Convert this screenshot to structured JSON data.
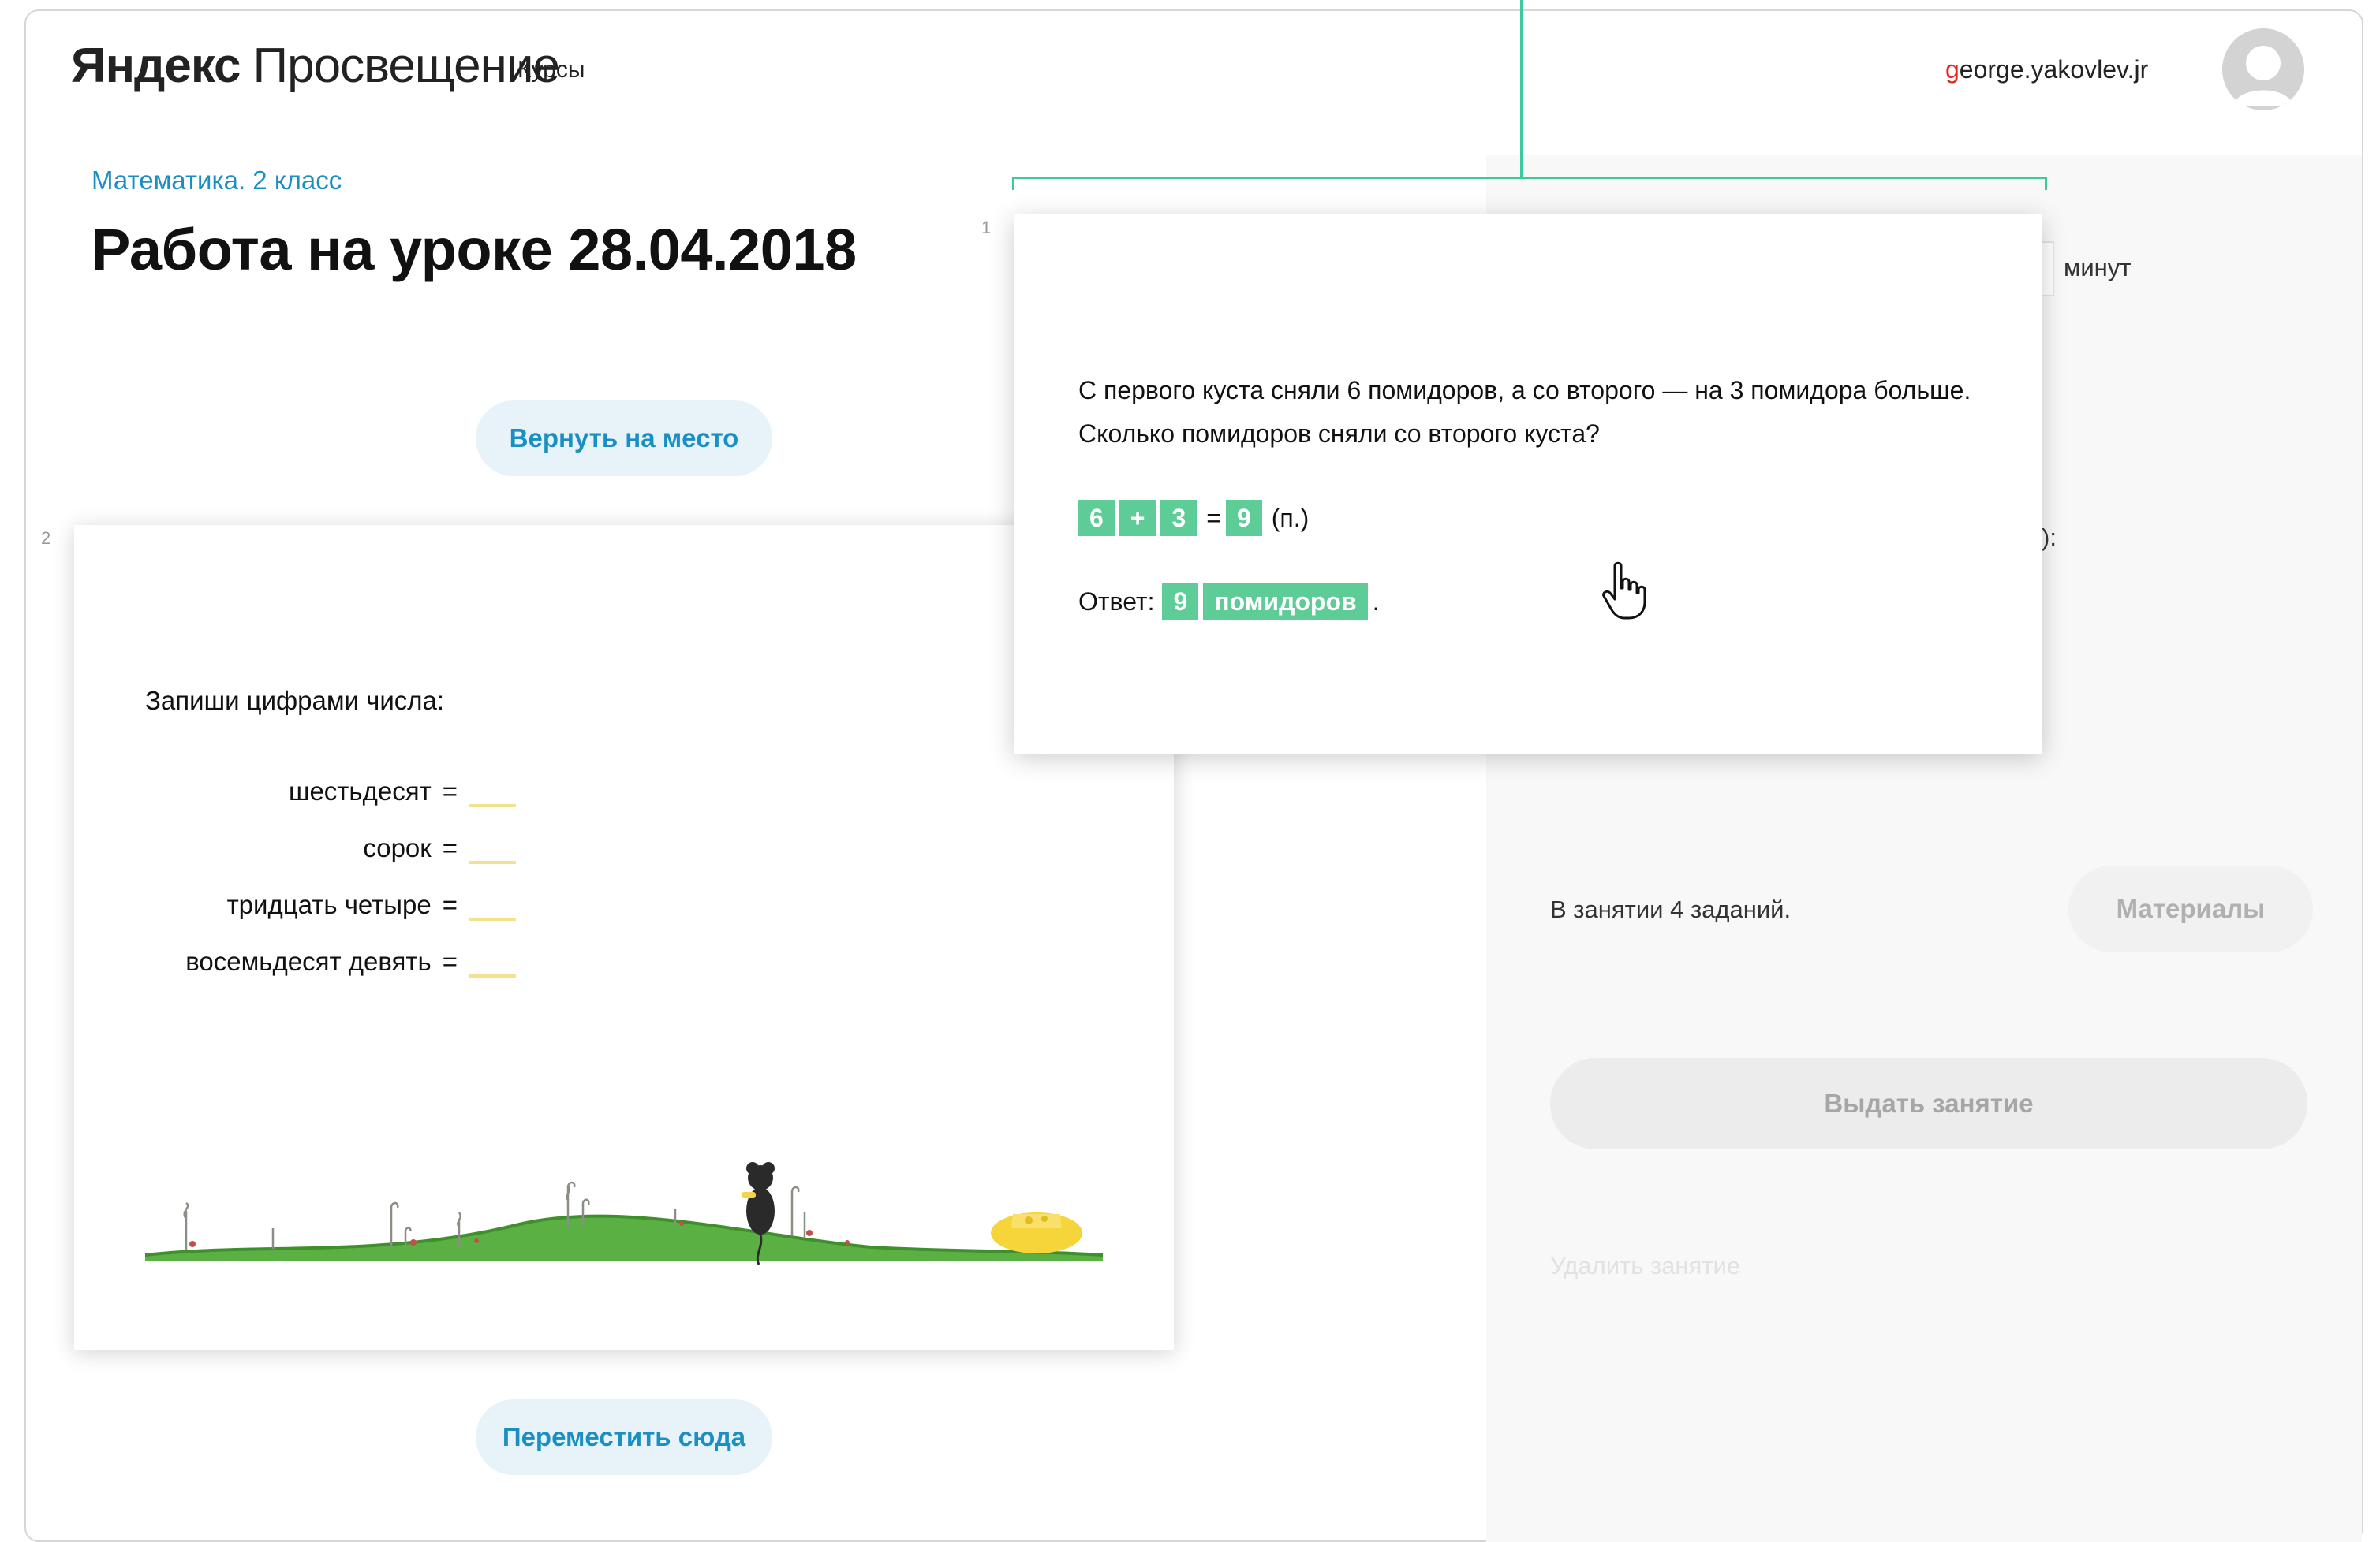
{
  "header": {
    "logo_yandex": "Яндекс",
    "logo_product": "Просвещение",
    "nav_courses": "Курсы",
    "username_first": "g",
    "username_rest": "eorge.yakovlev.jr"
  },
  "breadcrumb": "Математика. 2 класс",
  "page_title": "Работа на уроке 28.04.2018",
  "buttons": {
    "return": "Вернуть на место",
    "move": "Переместить сюда"
  },
  "task1": {
    "number": "1",
    "question_line1": "С первого куста сняли 6 помидоров, а со второго — на 3 помидора больше.",
    "question_line2": "Сколько помидоров сняли со второго куста?",
    "equation": {
      "a": "6",
      "op": "+",
      "b": "3",
      "eq": "=",
      "result": "9",
      "unit": "(п.)"
    },
    "answer": {
      "label": "Ответ:",
      "value": "9",
      "word": "помидоров",
      "dot": "."
    }
  },
  "task2": {
    "number": "2",
    "prompt": "Запиши цифрами числа:",
    "rows": [
      {
        "label": "шестьдесят",
        "eq": "="
      },
      {
        "label": "сорок",
        "eq": "="
      },
      {
        "label": "тридцать четыре",
        "eq": "="
      },
      {
        "label": "восемьдесят девять",
        "eq": "="
      }
    ]
  },
  "right_panel": {
    "minutes": "минут",
    "colon_fragment": "):",
    "tasks_count": "В занятии 4 заданий.",
    "materials": "Материалы",
    "issue": "Выдать занятие",
    "delete": "Удалить занятие"
  },
  "colors": {
    "accent_blue": "#1a8fc3",
    "chip_green": "#5dcc97",
    "bracket_green": "#3ec89e",
    "logo_red": "#e52620"
  }
}
